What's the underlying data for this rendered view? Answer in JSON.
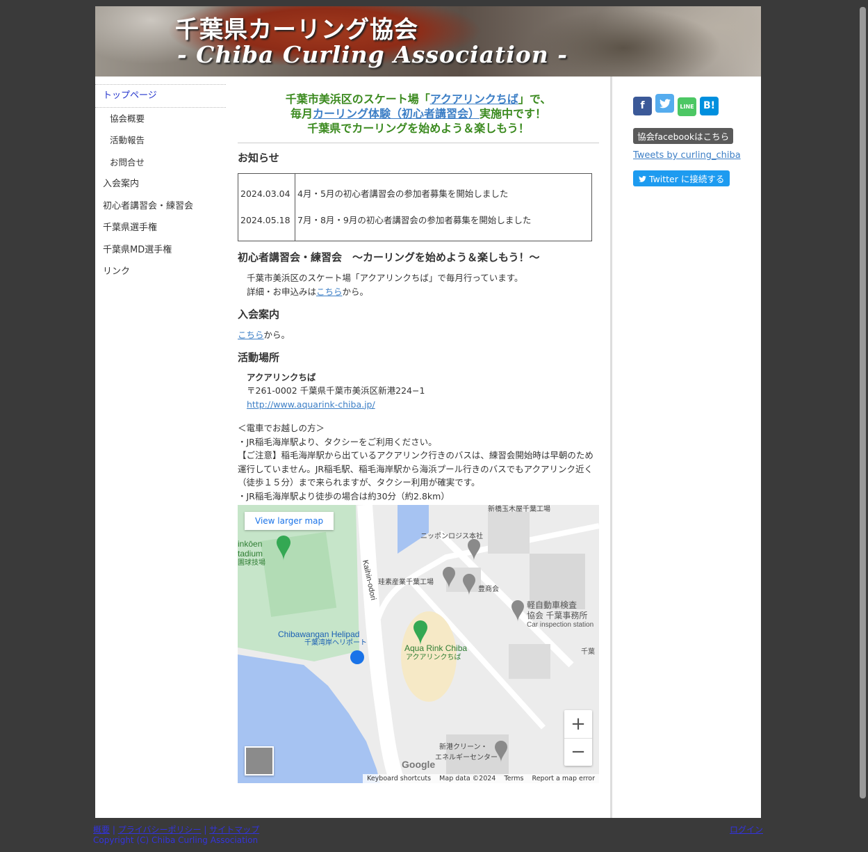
{
  "banner": {
    "title_ja": "千葉県カーリング協会",
    "title_en": "- Chiba Curling Association -"
  },
  "nav": {
    "items": [
      {
        "label": "トップページ"
      },
      {
        "label": "協会概要"
      },
      {
        "label": "活動報告"
      },
      {
        "label": "お問合せ"
      },
      {
        "label": "入会案内"
      },
      {
        "label": "初心者講習会・練習会"
      },
      {
        "label": "千葉県選手権"
      },
      {
        "label": "千葉県MD選手権"
      },
      {
        "label": "リンク"
      }
    ]
  },
  "headline": {
    "l1_a": "千葉市美浜区のスケート場「",
    "l1_link": "アクアリンクちば",
    "l1_b": "」で、",
    "l2_a": "毎月",
    "l2_link": "カーリング体験（初心者講習会）",
    "l2_b": "実施中です！",
    "l3": "千葉県でカーリングを始めよう＆楽しもう！"
  },
  "news": {
    "heading": "お知らせ",
    "rows": [
      {
        "date": "2024.03.04",
        "text": "4月・5月の初心者講習会の参加者募集を開始しました"
      },
      {
        "date": "2024.05.18",
        "text": "7月・8月・9月の初心者講習会の参加者募集を開始しました"
      }
    ]
  },
  "lesson": {
    "heading": "初心者講習会・練習会　～カーリングを始めよう＆楽しもう！～",
    "line1": "千葉市美浜区のスケート場「アクアリンクちば」で毎月行っています。",
    "line2_a": "詳細・お申込みは",
    "line2_link": "こちら",
    "line2_b": "から。"
  },
  "join": {
    "heading": "入会案内",
    "link": "こちら",
    "suffix": "から。"
  },
  "venue": {
    "heading": "活動場所",
    "name": "アクアリンクちば",
    "address": "〒261-0002 千葉県千葉市美浜区新港224−1",
    "url": "http://www.aquarink-chiba.jp/"
  },
  "access": {
    "l1": "＜電車でお越しの方＞",
    "l2": "・JR稲毛海岸駅より、タクシーをご利用ください。",
    "l3": "【ご注意】稲毛海岸駅から出ているアクアリンク行きのバスは、練習会開始時は早朝のため運行していません。JR稲毛駅、稲毛海岸駅から海浜プール行きのバスでもアクアリンク近く（徒歩１５分）まで来られますが、タクシー利用が確実です。",
    "l4": "・JR稲毛海岸駅より徒歩の場合は約30分（約2.8km）"
  },
  "map": {
    "view_larger": "View larger map",
    "labels": {
      "stadium1": "inkōen",
      "stadium2": "tadium",
      "stadium3": "園球技場",
      "road": "Kaihin-odori",
      "helipad_en": "Chibawangan Helipad",
      "helipad_ja": "千葉湾岸ヘリポート",
      "rink_en": "Aqua Rink Chiba",
      "rink_ja": "アクアリンクちば",
      "nippon": "ニッポンロジス本社",
      "shinbashi": "新橋玉木屋千葉工場",
      "keiso": "珪素産業千葉工場",
      "hoshokai": "豊商会",
      "kei1": "軽自動車検査",
      "kei2": "協会 千葉事務所",
      "kei3": "Car inspection station",
      "chiba_cut": "千葉",
      "clean1": "新港クリーン・",
      "clean2": "エネルギーセンター",
      "google": "Google"
    },
    "footer": {
      "shortcuts": "Keyboard shortcuts",
      "data": "Map data ©2024",
      "terms": "Terms",
      "report": "Report a map error"
    }
  },
  "sidebar": {
    "social": [
      {
        "label": "f",
        "color": "#3b5998",
        "icon": "facebook-icon"
      },
      {
        "label": "t",
        "color": "#55acee",
        "icon": "twitter-icon"
      },
      {
        "label": "LINE",
        "color": "#4cc764",
        "icon": "line-icon"
      },
      {
        "label": "B!",
        "color": "#008fde",
        "icon": "hatena-bookmark-icon"
      }
    ],
    "facebook_btn": "協会facebookはこちら",
    "tweets_link": "Tweets by curling_chiba",
    "twitter_btn": "Twitter に接続する"
  },
  "footer": {
    "link1": "概要",
    "link2": "プライバシーポリシー",
    "link3": "サイトマップ",
    "sep": "|",
    "login": "ログイン",
    "copyright": "Copyright (C) Chiba Curling Association"
  }
}
